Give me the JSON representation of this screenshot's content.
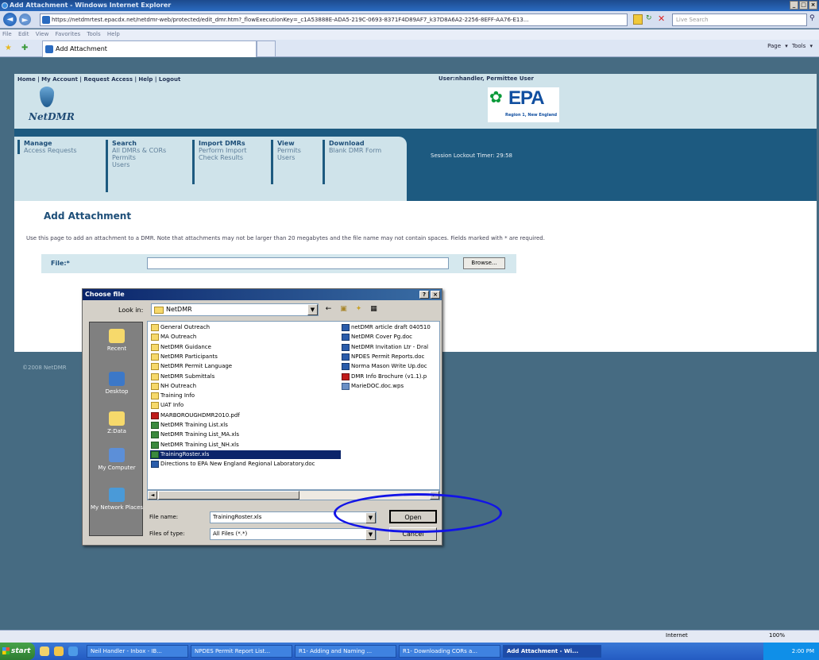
{
  "browser": {
    "title": "Add Attachment - Windows Internet Explorer",
    "url": "https://netdmrtest.epacdx.net/netdmr-web/protected/edit_dmr.htm?_flowExecutionKey=_c1A53888E-ADA5-219C-0693-8371F4D89AF7_k37D8A6A2-2256-8EFF-AA76-E13...",
    "search_placeholder": "Live Search",
    "menu": "File  Edit  View  Favorites  Tools  Help",
    "tab_label": "Add Attachment",
    "right_tools": "Page ▾  Tools ▾",
    "status_zone": "Internet",
    "zoom": "100%"
  },
  "site": {
    "top_links": "Home | My Account | Request Access | Help | Logout",
    "user": "User:nhandler, Permittee User",
    "logo_text": "NetDMR",
    "epa_text": "EPA",
    "epa_region": "Region 1, New England",
    "nav": [
      {
        "heading": "Manage",
        "items": [
          "Access Requests"
        ]
      },
      {
        "heading": "Search",
        "items": [
          "All DMRs & CORs",
          "Permits",
          "Users"
        ]
      },
      {
        "heading": "Import DMRs",
        "items": [
          "Perform Import",
          "Check Results"
        ]
      },
      {
        "heading": "View",
        "items": [
          "Permits",
          "Users"
        ]
      },
      {
        "heading": "Download",
        "items": [
          "Blank DMR Form"
        ]
      }
    ],
    "lockout": "Session Lockout Timer: 29:58",
    "page_title": "Add Attachment",
    "instructions": "Use this page to add an attachment to a DMR. Note that attachments may not be larger than 20 megabytes and the file name may not contain spaces. Fields marked with * are required.",
    "file_label": "File:*",
    "browse_label": "Browse...",
    "copyright": "©2008 NetDMR"
  },
  "dialog": {
    "title": "Choose file",
    "look_in_label": "Look in:",
    "look_in_value": "NetDMR",
    "places": [
      "Recent",
      "Desktop",
      "Z:Data",
      "My Computer",
      "My Network Places"
    ],
    "files_col1": [
      {
        "name": "General Outreach",
        "type": "folder"
      },
      {
        "name": "MA Outreach",
        "type": "folder"
      },
      {
        "name": "NetDMR Guidance",
        "type": "folder"
      },
      {
        "name": "NetDMR Participants",
        "type": "folder"
      },
      {
        "name": "NetDMR Permit Language",
        "type": "folder"
      },
      {
        "name": "NetDMR Submittals",
        "type": "folder"
      },
      {
        "name": "NH Outreach",
        "type": "folder"
      },
      {
        "name": "Training Info",
        "type": "folder"
      },
      {
        "name": "UAT Info",
        "type": "folder"
      },
      {
        "name": "MARBOROUGHDMR2010.pdf",
        "type": "pdf"
      },
      {
        "name": "NetDMR Training List.xls",
        "type": "xls"
      },
      {
        "name": "NetDMR Training List_MA.xls",
        "type": "xls"
      },
      {
        "name": "NetDMR Training List_NH.xls",
        "type": "xls"
      },
      {
        "name": "TrainingRoster.xls",
        "type": "xls",
        "selected": true
      },
      {
        "name": "Directions to EPA New England Regional Laboratory.doc",
        "type": "doc"
      }
    ],
    "files_col2": [
      {
        "name": "netDMR article draft 040510",
        "type": "doc"
      },
      {
        "name": "NetDMR Cover Pg.doc",
        "type": "doc"
      },
      {
        "name": "NetDMR Invitation Ltr - Dral",
        "type": "doc"
      },
      {
        "name": "NPDES Permit Reports.doc",
        "type": "doc"
      },
      {
        "name": "Norma Mason Write Up.doc",
        "type": "doc"
      },
      {
        "name": "DMR Info Brochure (v1.1).p",
        "type": "pdf"
      },
      {
        "name": "MarieDOC.doc.wps",
        "type": "wps"
      }
    ],
    "file_name_label": "File name:",
    "file_name_value": "TrainingRoster.xls",
    "files_of_type_label": "Files of type:",
    "files_of_type_value": "All Files (*.*)",
    "open_label": "Open",
    "cancel_label": "Cancel"
  },
  "taskbar": {
    "start": "start",
    "tasks": [
      {
        "label": "Neil Handler - Inbox - IB...",
        "active": false
      },
      {
        "label": "NPDES Permit Report List...",
        "active": false
      },
      {
        "label": "R1- Adding and Naming ...",
        "active": false
      },
      {
        "label": "R1- Downloading CORs a...",
        "active": false
      },
      {
        "label": "Add Attachment - Wi...",
        "active": true
      }
    ],
    "clock": "2:00 PM"
  }
}
